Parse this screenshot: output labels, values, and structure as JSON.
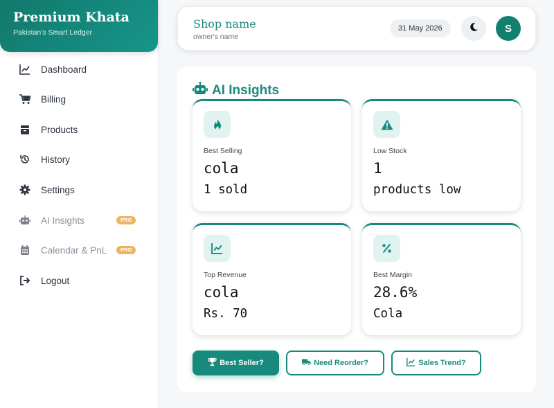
{
  "brand": {
    "title": "Premium Khata",
    "subtitle": "Pakistan's Smart Ledger"
  },
  "sidebar": {
    "items": [
      {
        "label": "Dashboard",
        "icon": "chart-line-icon"
      },
      {
        "label": "Billing",
        "icon": "cart-icon"
      },
      {
        "label": "Products",
        "icon": "box-icon"
      },
      {
        "label": "History",
        "icon": "history-icon"
      },
      {
        "label": "Settings",
        "icon": "gear-icon"
      },
      {
        "label": "AI Insights",
        "icon": "robot-icon",
        "badge": "PRO"
      },
      {
        "label": "Calendar & PnL",
        "icon": "calendar-icon",
        "badge": "PRO"
      },
      {
        "label": "Logout",
        "icon": "logout-icon"
      }
    ]
  },
  "header": {
    "shop_name": "Shop name",
    "owner_name": "owner's name",
    "date": "31 May 2026",
    "avatar_initial": "S"
  },
  "section": {
    "title": "AI Insights"
  },
  "cards": [
    {
      "label": "Best Selling",
      "value": "cola",
      "sub": "1 sold",
      "icon": "fire-icon"
    },
    {
      "label": "Low Stock",
      "value": "1",
      "sub": "products low",
      "icon": "warning-icon"
    },
    {
      "label": "Top Revenue",
      "value": "cola",
      "sub": "Rs. 70",
      "icon": "chart-line-icon"
    },
    {
      "label": "Best Margin",
      "value": "28.6%",
      "sub": "Cola",
      "icon": "percent-icon"
    }
  ],
  "actions": {
    "best_seller": "Best Seller?",
    "need_reorder": "Need Reorder?",
    "sales_trend": "Sales Trend?"
  },
  "colors": {
    "accent": "#178a7d",
    "pro_badge": "#f2b35f"
  }
}
